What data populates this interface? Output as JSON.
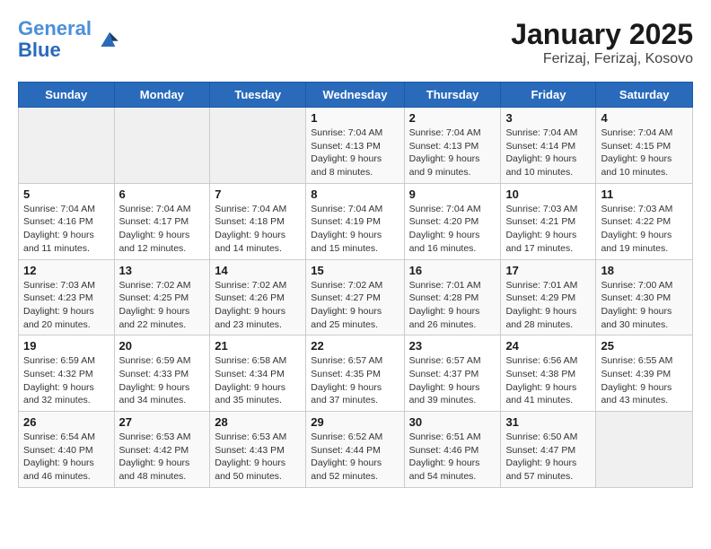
{
  "header": {
    "logo_line1": "General",
    "logo_line2": "Blue",
    "month_title": "January 2025",
    "location": "Ferizaj, Ferizaj, Kosovo"
  },
  "weekdays": [
    "Sunday",
    "Monday",
    "Tuesday",
    "Wednesday",
    "Thursday",
    "Friday",
    "Saturday"
  ],
  "weeks": [
    [
      {
        "day": "",
        "info": ""
      },
      {
        "day": "",
        "info": ""
      },
      {
        "day": "",
        "info": ""
      },
      {
        "day": "1",
        "info": "Sunrise: 7:04 AM\nSunset: 4:13 PM\nDaylight: 9 hours\nand 8 minutes."
      },
      {
        "day": "2",
        "info": "Sunrise: 7:04 AM\nSunset: 4:13 PM\nDaylight: 9 hours\nand 9 minutes."
      },
      {
        "day": "3",
        "info": "Sunrise: 7:04 AM\nSunset: 4:14 PM\nDaylight: 9 hours\nand 10 minutes."
      },
      {
        "day": "4",
        "info": "Sunrise: 7:04 AM\nSunset: 4:15 PM\nDaylight: 9 hours\nand 10 minutes."
      }
    ],
    [
      {
        "day": "5",
        "info": "Sunrise: 7:04 AM\nSunset: 4:16 PM\nDaylight: 9 hours\nand 11 minutes."
      },
      {
        "day": "6",
        "info": "Sunrise: 7:04 AM\nSunset: 4:17 PM\nDaylight: 9 hours\nand 12 minutes."
      },
      {
        "day": "7",
        "info": "Sunrise: 7:04 AM\nSunset: 4:18 PM\nDaylight: 9 hours\nand 14 minutes."
      },
      {
        "day": "8",
        "info": "Sunrise: 7:04 AM\nSunset: 4:19 PM\nDaylight: 9 hours\nand 15 minutes."
      },
      {
        "day": "9",
        "info": "Sunrise: 7:04 AM\nSunset: 4:20 PM\nDaylight: 9 hours\nand 16 minutes."
      },
      {
        "day": "10",
        "info": "Sunrise: 7:03 AM\nSunset: 4:21 PM\nDaylight: 9 hours\nand 17 minutes."
      },
      {
        "day": "11",
        "info": "Sunrise: 7:03 AM\nSunset: 4:22 PM\nDaylight: 9 hours\nand 19 minutes."
      }
    ],
    [
      {
        "day": "12",
        "info": "Sunrise: 7:03 AM\nSunset: 4:23 PM\nDaylight: 9 hours\nand 20 minutes."
      },
      {
        "day": "13",
        "info": "Sunrise: 7:02 AM\nSunset: 4:25 PM\nDaylight: 9 hours\nand 22 minutes."
      },
      {
        "day": "14",
        "info": "Sunrise: 7:02 AM\nSunset: 4:26 PM\nDaylight: 9 hours\nand 23 minutes."
      },
      {
        "day": "15",
        "info": "Sunrise: 7:02 AM\nSunset: 4:27 PM\nDaylight: 9 hours\nand 25 minutes."
      },
      {
        "day": "16",
        "info": "Sunrise: 7:01 AM\nSunset: 4:28 PM\nDaylight: 9 hours\nand 26 minutes."
      },
      {
        "day": "17",
        "info": "Sunrise: 7:01 AM\nSunset: 4:29 PM\nDaylight: 9 hours\nand 28 minutes."
      },
      {
        "day": "18",
        "info": "Sunrise: 7:00 AM\nSunset: 4:30 PM\nDaylight: 9 hours\nand 30 minutes."
      }
    ],
    [
      {
        "day": "19",
        "info": "Sunrise: 6:59 AM\nSunset: 4:32 PM\nDaylight: 9 hours\nand 32 minutes."
      },
      {
        "day": "20",
        "info": "Sunrise: 6:59 AM\nSunset: 4:33 PM\nDaylight: 9 hours\nand 34 minutes."
      },
      {
        "day": "21",
        "info": "Sunrise: 6:58 AM\nSunset: 4:34 PM\nDaylight: 9 hours\nand 35 minutes."
      },
      {
        "day": "22",
        "info": "Sunrise: 6:57 AM\nSunset: 4:35 PM\nDaylight: 9 hours\nand 37 minutes."
      },
      {
        "day": "23",
        "info": "Sunrise: 6:57 AM\nSunset: 4:37 PM\nDaylight: 9 hours\nand 39 minutes."
      },
      {
        "day": "24",
        "info": "Sunrise: 6:56 AM\nSunset: 4:38 PM\nDaylight: 9 hours\nand 41 minutes."
      },
      {
        "day": "25",
        "info": "Sunrise: 6:55 AM\nSunset: 4:39 PM\nDaylight: 9 hours\nand 43 minutes."
      }
    ],
    [
      {
        "day": "26",
        "info": "Sunrise: 6:54 AM\nSunset: 4:40 PM\nDaylight: 9 hours\nand 46 minutes."
      },
      {
        "day": "27",
        "info": "Sunrise: 6:53 AM\nSunset: 4:42 PM\nDaylight: 9 hours\nand 48 minutes."
      },
      {
        "day": "28",
        "info": "Sunrise: 6:53 AM\nSunset: 4:43 PM\nDaylight: 9 hours\nand 50 minutes."
      },
      {
        "day": "29",
        "info": "Sunrise: 6:52 AM\nSunset: 4:44 PM\nDaylight: 9 hours\nand 52 minutes."
      },
      {
        "day": "30",
        "info": "Sunrise: 6:51 AM\nSunset: 4:46 PM\nDaylight: 9 hours\nand 54 minutes."
      },
      {
        "day": "31",
        "info": "Sunrise: 6:50 AM\nSunset: 4:47 PM\nDaylight: 9 hours\nand 57 minutes."
      },
      {
        "day": "",
        "info": ""
      }
    ]
  ]
}
